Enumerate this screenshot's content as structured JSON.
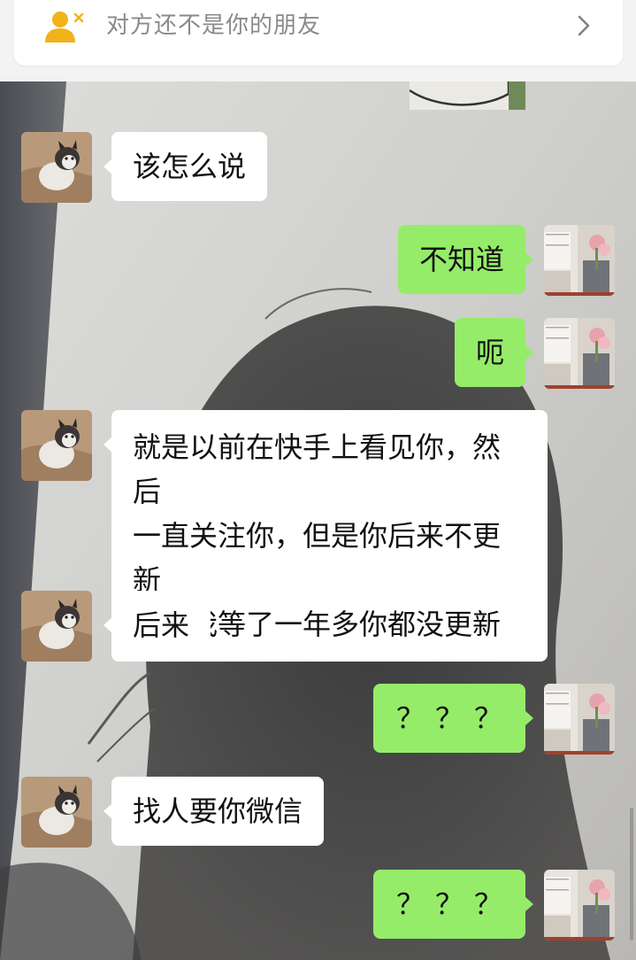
{
  "header": {
    "notice_text": "对方还不是你的朋友",
    "notice_icon": "add-friend-x-icon",
    "chevron_icon": "chevron-right-icon"
  },
  "colors": {
    "incoming_bubble": "#ffffff",
    "outgoing_bubble": "#95ec69",
    "notice_text": "#8a8a8a",
    "icon_yellow": "#f2b21b"
  },
  "messages": [
    {
      "sender": "them",
      "text": "该怎么说"
    },
    {
      "sender": "me",
      "text": "不知道"
    },
    {
      "sender": "me",
      "text": "呃"
    },
    {
      "sender": "them",
      "lines": [
        "就是以前在快手上看见你，然后",
        "一直关注你，但是你后来不更新",
        "了，我等了一年多你都没更新"
      ]
    },
    {
      "sender": "them",
      "text": "后来"
    },
    {
      "sender": "me",
      "text": "？？？"
    },
    {
      "sender": "them",
      "text": "找人要你微信"
    },
    {
      "sender": "me",
      "text": "？？？"
    }
  ]
}
